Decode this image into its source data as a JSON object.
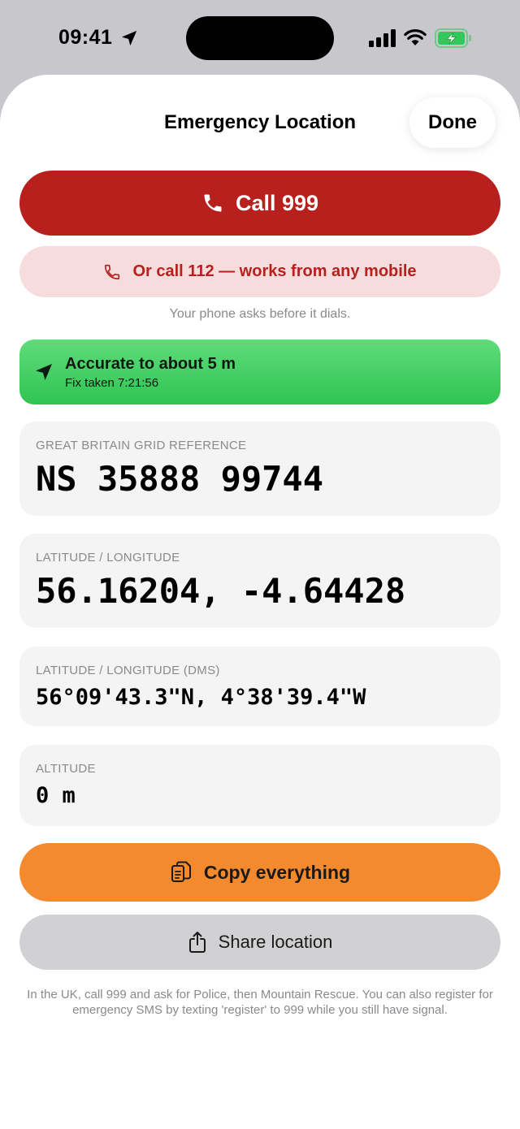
{
  "status_bar": {
    "time": "09:41",
    "icons": [
      "location-arrow-icon",
      "signal-bars-icon",
      "wifi-icon",
      "battery-charging-icon"
    ],
    "battery_color": "#34c759"
  },
  "header": {
    "title": "Emergency Location",
    "done_label": "Done"
  },
  "actions": {
    "call_999_label": "Call 999",
    "call_112_label": "Or call 112 — works from any mobile",
    "dial_note": "Your phone asks before it dials.",
    "copy_label": "Copy everything",
    "share_label": "Share location"
  },
  "accuracy": {
    "title": "Accurate to about 5 m",
    "fix_time": "Fix taken 7:21:56"
  },
  "cards": {
    "grid_ref": {
      "label": "GREAT BRITAIN GRID REFERENCE",
      "value": "NS 35888 99744"
    },
    "latlon": {
      "label": "LATITUDE / LONGITUDE",
      "value": "56.16204, -4.64428"
    },
    "dms": {
      "label": "LATITUDE / LONGITUDE (DMS)",
      "value": "56°09'43.3\"N, 4°38'39.4\"W"
    },
    "altitude": {
      "label": "ALTITUDE",
      "value": "0 m"
    }
  },
  "footer": {
    "note": "In the UK, call 999 and ask for Police, then Mountain Rescue. You can also register for emergency SMS by texting 'register' to 999 while you still have signal."
  },
  "colors": {
    "call_999": "#b8201d",
    "call_112_bg": "#f6dcdc",
    "accuracy_green": "#34c759",
    "copy_orange": "#f48a2e",
    "share_grey": "#d1d1d3"
  }
}
